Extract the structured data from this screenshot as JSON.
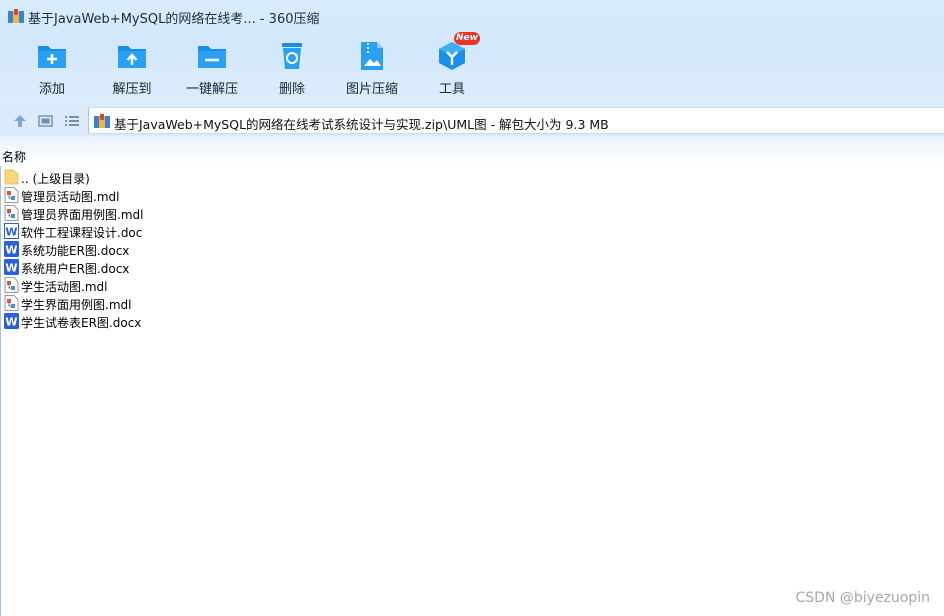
{
  "window": {
    "title": "基于JavaWeb+MySQL的网络在线考... - 360压缩"
  },
  "toolbar": {
    "add": "添加",
    "extract_to": "解压到",
    "one_click_extract": "一键解压",
    "delete": "删除",
    "image_compress": "图片压缩",
    "tools": "工具",
    "new_badge": "New"
  },
  "address": {
    "path": "基于JavaWeb+MySQL的网络在线考试系统设计与实现.zip\\UML图 - 解包大小为 9.3 MB"
  },
  "list": {
    "column_name": "名称",
    "items": [
      {
        "name": ".. (上级目录)",
        "icon": "folder-icon"
      },
      {
        "name": "管理员活动图.mdl",
        "icon": "mdl-file-icon"
      },
      {
        "name": "管理员界面用例图.mdl",
        "icon": "mdl-file-icon"
      },
      {
        "name": "软件工程课程设计.doc",
        "icon": "doc-file-icon"
      },
      {
        "name": "系统功能ER图.docx",
        "icon": "docx-file-icon"
      },
      {
        "name": "系统用户ER图.docx",
        "icon": "docx-file-icon"
      },
      {
        "name": "学生活动图.mdl",
        "icon": "mdl-file-icon"
      },
      {
        "name": "学生界面用例图.mdl",
        "icon": "mdl-file-icon"
      },
      {
        "name": "学生试卷表ER图.docx",
        "icon": "docx-file-icon"
      }
    ]
  },
  "watermark": "CSDN @biyezuopin",
  "colors": {
    "accent_blue": "#1a8fea",
    "word_blue": "#2b5fd9",
    "badge_red": "#e8322a"
  }
}
